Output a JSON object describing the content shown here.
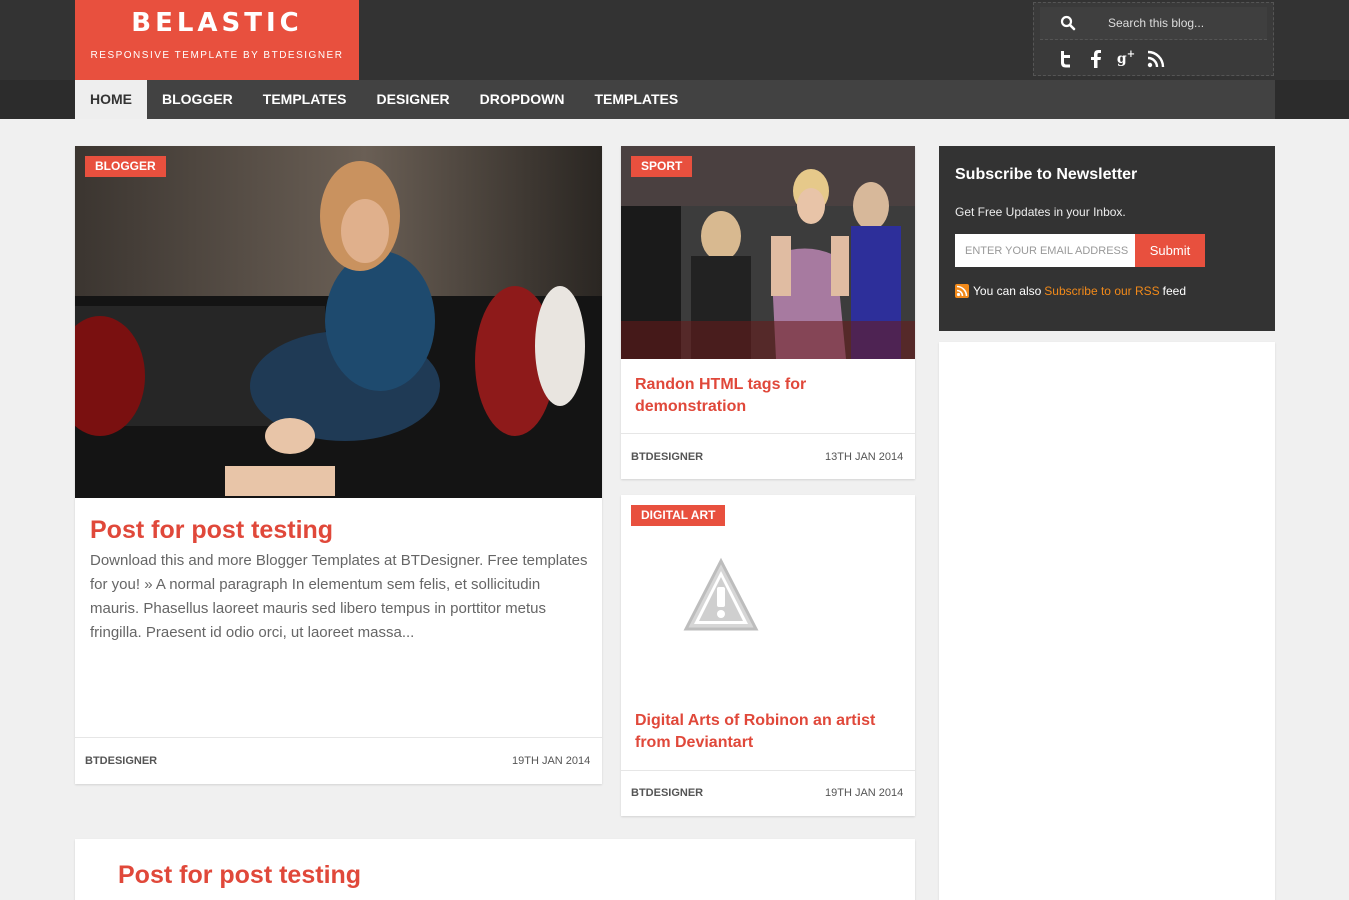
{
  "site": {
    "title": "BELASTIC",
    "tagline": "RESPONSIVE TEMPLATE BY BTDESIGNER",
    "brand_color": "#e8503e"
  },
  "search": {
    "placeholder": "Search this blog..."
  },
  "social_icons": [
    "twitter-icon",
    "facebook-icon",
    "google-plus-icon",
    "rss-icon"
  ],
  "nav": {
    "items": [
      "HOME",
      "BLOGGER",
      "TEMPLATES",
      "DESIGNER",
      "DROPDOWN",
      "TEMPLATES"
    ],
    "active": "HOME"
  },
  "posts": [
    {
      "tag": "BLOGGER",
      "title": "Post for post testing",
      "excerpt": "Download this and more Blogger Templates at BTDesigner. Free templates for you! » A normal paragraph In elementum sem felis, et sollicitudin mauris. Phasellus laoreet mauris sed libero tempus in porttitor metus fringilla. Praesent id odio orci, ut laoreet massa...",
      "author": "BTDESIGNER",
      "date": "19TH JAN 2014"
    },
    {
      "tag": "SPORT",
      "title": "Randon HTML tags for demonstration",
      "author": "BTDESIGNER",
      "date": "13TH JAN 2014"
    },
    {
      "tag": "DIGITAL ART",
      "title": "Digital Arts of Robinon an artist from Deviantart",
      "author": "BTDESIGNER",
      "date": "19TH JAN 2014"
    },
    {
      "title": "Post for post testing"
    }
  ],
  "newsletter": {
    "title": "Subscribe to Newsletter",
    "text": "Get Free Updates in your Inbox.",
    "email_placeholder": "ENTER YOUR EMAIL ADDRESS",
    "submit_label": "Submit",
    "rss_prefix": "You can also",
    "rss_link": "Subscribe to our RSS",
    "rss_suffix": "feed"
  }
}
